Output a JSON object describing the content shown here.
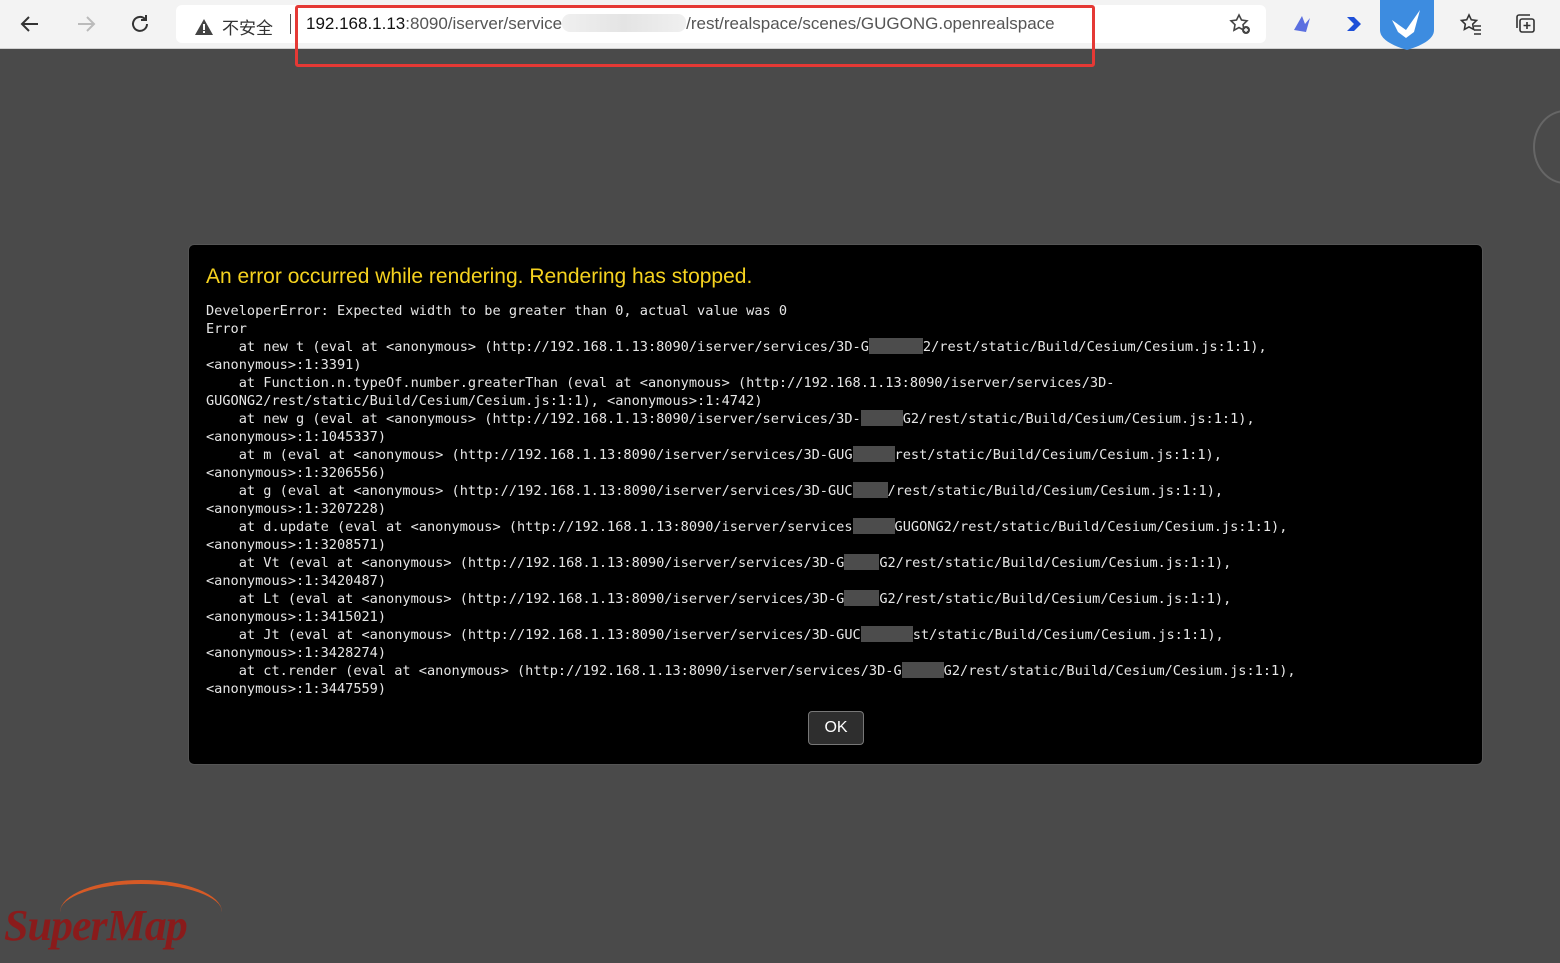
{
  "browser": {
    "insecure_label": "不安全",
    "url_host": "192.168.1.13",
    "url_before": ":8090/iserver/service",
    "url_after": "/rest/realspace/scenes/GUGONG.openrealspace"
  },
  "dialog": {
    "title": "An error occurred while rendering. Rendering has stopped.",
    "message": [
      "DeveloperError: Expected width to be greater than 0, actual value was 0",
      "Error",
      "    at new t (eval at <anonymous> (http://192.168.1.13:8090/iserver/services/3D-G",
      "2/rest/static/Build/Cesium/Cesium.js:1:1),",
      "<anonymous>:1:3391)",
      "    at Function.n.typeOf.number.greaterThan (eval at <anonymous> (http://192.168.1.13:8090/iserver/services/3D-",
      "GUGONG2/rest/static/Build/Cesium/Cesium.js:1:1), <anonymous>:1:4742)",
      "    at new g (eval at <anonymous> (http://192.168.1.13:8090/iserver/services/3D-",
      "G2/rest/static/Build/Cesium/Cesium.js:1:1),",
      "<anonymous>:1:1045337)",
      "    at m (eval at <anonymous> (http://192.168.1.13:8090/iserver/services/3D-GUG",
      "rest/static/Build/Cesium/Cesium.js:1:1),",
      "<anonymous>:1:3206556)",
      "    at g (eval at <anonymous> (http://192.168.1.13:8090/iserver/services/3D-GUC",
      "/rest/static/Build/Cesium/Cesium.js:1:1),",
      "<anonymous>:1:3207228)",
      "    at d.update (eval at <anonymous> (http://192.168.1.13:8090/iserver/services",
      "GUGONG2/rest/static/Build/Cesium/Cesium.js:1:1),",
      "<anonymous>:1:3208571)",
      "    at Vt (eval at <anonymous> (http://192.168.1.13:8090/iserver/services/3D-G",
      "G2/rest/static/Build/Cesium/Cesium.js:1:1),",
      "<anonymous>:1:3420487)",
      "    at Lt (eval at <anonymous> (http://192.168.1.13:8090/iserver/services/3D-G",
      "G2/rest/static/Build/Cesium/Cesium.js:1:1),",
      "<anonymous>:1:3415021)",
      "    at Jt (eval at <anonymous> (http://192.168.1.13:8090/iserver/services/3D-GUC",
      "st/static/Build/Cesium/Cesium.js:1:1),",
      "<anonymous>:1:3428274)",
      "    at ct.render (eval at <anonymous> (http://192.168.1.13:8090/iserver/services/3D-G",
      "G2/rest/static/Build/Cesium/Cesium.js:1:1),",
      "<anonymous>:1:3447559)"
    ],
    "ok_label": "OK"
  },
  "logo_text": "SuperMap"
}
